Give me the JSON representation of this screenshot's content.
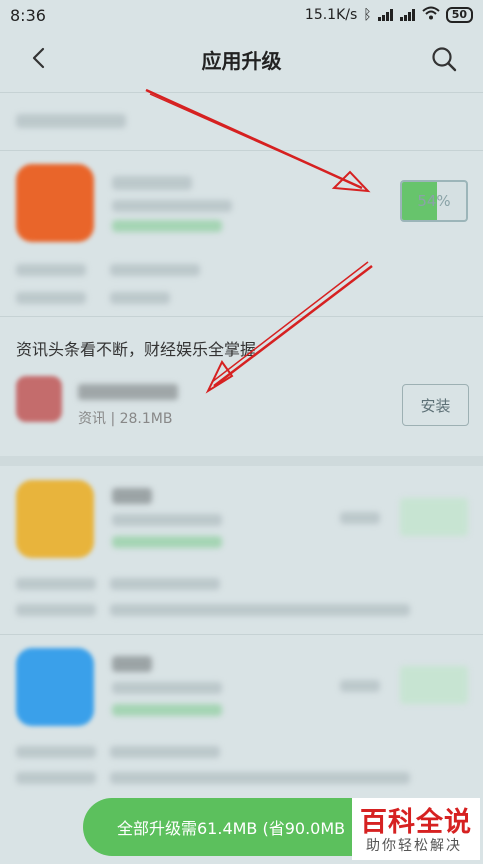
{
  "status_bar": {
    "time": "8:36",
    "net_speed": "15.1K/s",
    "battery": "50"
  },
  "header": {
    "title": "应用升级",
    "back_icon": "chevron-left-icon",
    "search_icon": "search-icon"
  },
  "downloading_app": {
    "progress_label": "54%",
    "progress_fraction": 0.54
  },
  "recommendation": {
    "title": "资讯头条看不断，财经娱乐全掌握",
    "meta": "资讯 | 28.1MB",
    "install_label": "安装"
  },
  "upgrade_all": {
    "label": "全部升级需61.4MB (省90.0MB"
  },
  "watermark": {
    "main": "百科全说",
    "sub": "助你轻松解决"
  },
  "colors": {
    "accent_green": "#5cc05d",
    "arrow_red": "#d62121"
  }
}
